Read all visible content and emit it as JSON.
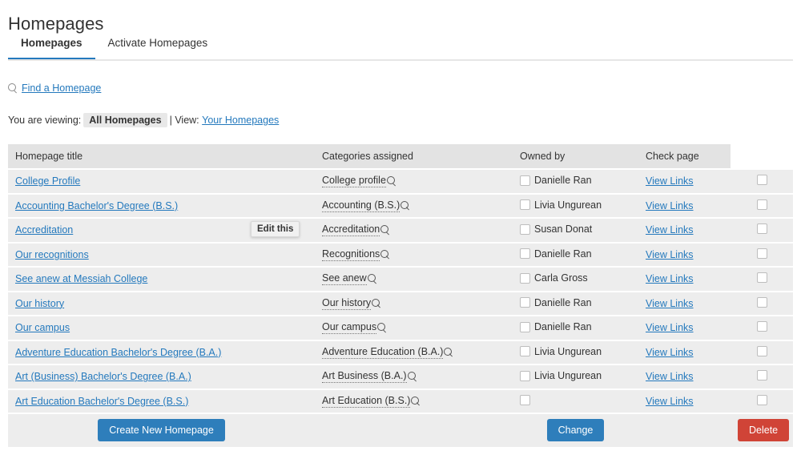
{
  "page": {
    "title": "Homepages"
  },
  "tabs": [
    {
      "label": "Homepages",
      "active": true
    },
    {
      "label": "Activate Homepages",
      "active": false
    }
  ],
  "find": {
    "icon": "search-icon",
    "link_label": "Find a Homepage"
  },
  "viewing": {
    "prefix": "You are viewing:",
    "current": "All Homepages",
    "separator": "| View:",
    "alternate_link": "Your Homepages"
  },
  "tooltip": {
    "label": "Edit this"
  },
  "table": {
    "columns": [
      "Homepage title",
      "Categories assigned",
      "Owned by",
      "Check page",
      ""
    ],
    "rows": [
      {
        "title": "College Profile",
        "category": "College profile",
        "owner": "Danielle Ran",
        "check": "View Links"
      },
      {
        "title": "Accounting Bachelor's Degree (B.S.)",
        "category": "Accounting (B.S.)",
        "owner": "Livia Ungurean",
        "check": "View Links"
      },
      {
        "title": "Accreditation",
        "category": "Accreditation",
        "owner": "Susan Donat",
        "check": "View Links"
      },
      {
        "title": "Our recognitions",
        "category": "Recognitions",
        "owner": "Danielle Ran",
        "check": "View Links"
      },
      {
        "title": "See anew at Messiah College",
        "category": "See anew",
        "owner": "Carla Gross",
        "check": "View Links"
      },
      {
        "title": "Our history",
        "category": "Our history",
        "owner": "Danielle Ran",
        "check": "View Links"
      },
      {
        "title": "Our campus",
        "category": "Our campus",
        "owner": "Danielle Ran",
        "check": "View Links"
      },
      {
        "title": "Adventure Education Bachelor's Degree (B.A.)",
        "category": "Adventure Education (B.A.)",
        "owner": "Livia Ungurean",
        "check": "View Links"
      },
      {
        "title": "Art (Business) Bachelor's Degree (B.A.)",
        "category": "Art Business (B.A.)",
        "owner": "Livia Ungurean",
        "check": "View Links"
      },
      {
        "title": "Art Education Bachelor's Degree (B.S.)",
        "category": "Art Education (B.S.)",
        "owner": "",
        "check": "View Links"
      }
    ],
    "actions": {
      "create": "Create New Homepage",
      "change": "Change",
      "delete": "Delete"
    }
  },
  "colors": {
    "link": "#2479bd",
    "primary_button": "#2e7ebb",
    "danger_button": "#d04437",
    "tab_underline": "#2479bd",
    "header_bg": "#e3e3e3",
    "row_bg": "#ededed"
  }
}
